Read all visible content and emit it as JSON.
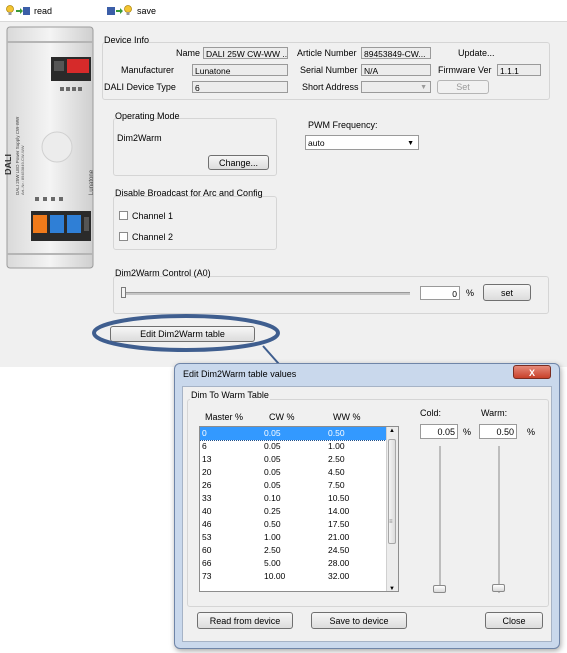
{
  "toolbar": {
    "read_label": "read",
    "save_label": "save"
  },
  "device_info": {
    "title": "Device Info",
    "name_label": "Name",
    "name_value": "DALI 25W CW-WW ...",
    "manufacturer_label": "Manufacturer",
    "manufacturer_value": "Lunatone",
    "device_type_label": "DALI Device Type",
    "device_type_value": "6",
    "article_label": "Article Number",
    "article_value": "89453849-CW...",
    "serial_label": "Serial Number",
    "serial_value": "N/A",
    "short_address_label": "Short Address",
    "short_address_value": "",
    "update_label": "Update...",
    "firmware_label": "Firmware Ver",
    "firmware_value": "1.1.1",
    "set_label": "Set"
  },
  "operating_mode": {
    "title": "Operating Mode",
    "value": "Dim2Warm",
    "change_label": "Change..."
  },
  "pwm": {
    "label": "PWM Frequency:",
    "value": "auto"
  },
  "broadcast": {
    "title": "Disable Broadcast  for Arc and Config",
    "channel1": "Channel 1",
    "channel2": "Channel 2"
  },
  "control": {
    "title": "Dim2Warm Control (A0)",
    "value": "0",
    "unit": "%",
    "set_label": "set",
    "slider_level": 0
  },
  "edit_button_label": "Edit Dim2Warm table",
  "device_label": {
    "brand": "DALI",
    "product": "DALI 25W LED Power Supply CW-WW",
    "maker": "Lunatone",
    "article": "Art.-Nr.: 89453849-CW-WW"
  },
  "dialog": {
    "title": "Edit Dim2Warm table values",
    "group_title": "Dim To Warm Table",
    "columns": [
      "Master %",
      "CW %",
      "WW %"
    ],
    "rows": [
      [
        "0",
        "0.05",
        "0.50"
      ],
      [
        "6",
        "0.05",
        "1.00"
      ],
      [
        "13",
        "0.05",
        "2.50"
      ],
      [
        "20",
        "0.05",
        "4.50"
      ],
      [
        "26",
        "0.05",
        "7.50"
      ],
      [
        "33",
        "0.10",
        "10.50"
      ],
      [
        "40",
        "0.25",
        "14.00"
      ],
      [
        "46",
        "0.50",
        "17.50"
      ],
      [
        "53",
        "1.00",
        "21.00"
      ],
      [
        "60",
        "2.50",
        "24.50"
      ],
      [
        "66",
        "5.00",
        "28.00"
      ],
      [
        "73",
        "10.00",
        "32.00"
      ]
    ],
    "cold_label": "Cold:",
    "cold_value": "0.05",
    "cold_unit": "%",
    "warm_label": "Warm:",
    "warm_value": "0.50",
    "warm_unit": "%",
    "read_button": "Read from device",
    "save_button": "Save to device",
    "close_button": "Close",
    "close_glyph": "X"
  },
  "colors": {
    "selection": "#3399ff",
    "callout": "#3f5e8f",
    "dialog_frame": "#c9d8ec"
  }
}
